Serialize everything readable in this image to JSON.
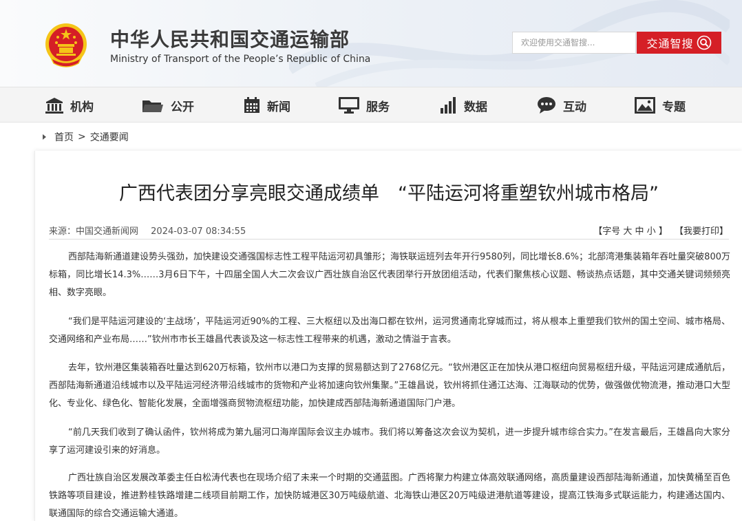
{
  "header": {
    "site_name_cn": "中华人民共和国交通运输部",
    "site_name_en": "Ministry of Transport of the People’s Republic of China",
    "search_placeholder": "欢迎使用交通智搜...",
    "search_button_label": "交通智搜"
  },
  "nav": {
    "items": [
      {
        "label": "机构",
        "icon": "building-icon"
      },
      {
        "label": "公开",
        "icon": "folder-icon"
      },
      {
        "label": "新闻",
        "icon": "calendar-icon"
      },
      {
        "label": "服务",
        "icon": "monitor-icon"
      },
      {
        "label": "数据",
        "icon": "bar-chart-icon"
      },
      {
        "label": "互动",
        "icon": "chat-icon"
      },
      {
        "label": "专题",
        "icon": "picture-icon"
      }
    ]
  },
  "breadcrumb": {
    "home": "首页",
    "separator": ">",
    "current": "交通要闻"
  },
  "article": {
    "title": "广西代表团分享亮眼交通成绩单　“平陆运河将重塑钦州城市格局”",
    "source": "来源：中国交通新闻网",
    "datetime": "2024-03-07 08:34:55",
    "font_size_prefix": "【字号",
    "font_large": "大",
    "font_medium": "中",
    "font_small": "小",
    "font_size_suffix": "】",
    "print_label": "【我要打印】",
    "paragraphs": [
      "西部陆海新通道建设势头强劲，加快建设交通强国标志性工程平陆运河初具雏形；海铁联运班列去年开行9580列，同比增长8.6%；北部湾港集装箱年吞吐量突破800万标箱，同比增长14.3%……3月6日下午，十四届全国人大二次会议广西壮族自治区代表团举行开放团组活动，代表们聚焦核心议题、畅谈热点话题，其中交通关键词频频亮相、数字亮眼。",
      "“我们是平陆运河建设的‘主战场’，平陆运河近90%的工程、三大枢纽以及出海口都在钦州，运河贯通南北穿城而过，将从根本上重塑我们钦州的国土空间、城市格局、交通网络和产业布局……”钦州市市长王雄昌代表谈及这一标志性工程带来的机遇，激动之情溢于言表。",
      "去年，钦州港区集装箱吞吐量达到620万标箱，钦州市以港口为支撑的贸易额达到了2768亿元。“钦州港区正在加快从港口枢纽向贸易枢纽升级，平陆运河建成通航后，西部陆海新通道沿线城市以及平陆运河经济带沿线城市的货物和产业将加速向钦州集聚。”王雄昌说，钦州将抓住通江达海、江海联动的优势，做强做优物流港，推动港口大型化、专业化、绿色化、智能化发展，全面增强商贸物流枢纽功能，加快建成西部陆海新通道国际门户港。",
      "“前几天我们收到了确认函件，钦州将成为第九届河口海岸国际会议主办城市。我们将以筹备这次会议为契机，进一步提升城市综合实力。”在发言最后，王雄昌向大家分享了运河建设引来的好消息。",
      "广西壮族自治区发展改革委主任白松涛代表也在现场介绍了未来一个时期的交通蓝图。广西将聚力构建立体高效联通网络，高质量建设西部陆海新通道，加快黄桶至百色铁路等项目建设，推进黔桂铁路增建二线项目前期工作，加快防城港区30万吨级航道、北海铁山港区20万吨级进港航道等建设，提高江铁海多式联运能力，构建通达国内、联通国际的综合交通运输大通道。"
    ]
  },
  "colors": {
    "accent_red": "#d51f26",
    "emblem_gold": "#f5c518",
    "nav_bg": "#f4f4f4"
  }
}
